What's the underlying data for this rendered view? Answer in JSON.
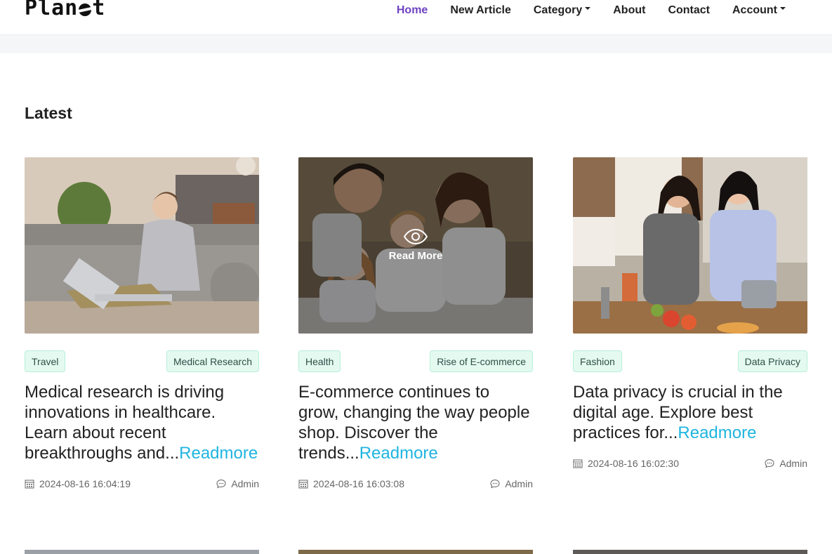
{
  "brand": {
    "logo_text_left": "Plan",
    "logo_text_right": "t",
    "logo_middle": "e"
  },
  "nav": {
    "items": [
      {
        "label": "Home",
        "active": true
      },
      {
        "label": "New Article"
      },
      {
        "label": "Category",
        "dropdown": true
      },
      {
        "label": "About"
      },
      {
        "label": "Contact"
      },
      {
        "label": "Account",
        "dropdown": true
      }
    ]
  },
  "section_title": "Latest",
  "overlay": {
    "label": "Read More"
  },
  "cards": [
    {
      "tag_left": "Travel",
      "tag_right": "Medical Research",
      "excerpt": "Medical research is driving innovations in healthcare. Learn about recent breakthroughs and...",
      "readmore": "Readmore",
      "date": "2024-08-16 16:04:19",
      "author": "Admin"
    },
    {
      "tag_left": "Health",
      "tag_right": "Rise of E-commerce",
      "excerpt": "E-commerce continues to grow, changing the way people shop. Discover the trends...",
      "readmore": "Readmore",
      "date": "2024-08-16 16:03:08",
      "author": "Admin"
    },
    {
      "tag_left": "Fashion",
      "tag_right": "Data Privacy",
      "excerpt": "Data privacy is crucial in the digital age. Explore best practices for...",
      "readmore": "Readmore",
      "date": "2024-08-16 16:02:30",
      "author": "Admin"
    }
  ],
  "icons": {
    "calendar": "calendar-icon",
    "comment": "comment-icon",
    "eye": "eye-icon"
  },
  "colors": {
    "accent": "#6f42c1",
    "readmore": "#1fb5e0",
    "tag_bg": "#e4faf1",
    "tag_border": "#b6efd9"
  }
}
